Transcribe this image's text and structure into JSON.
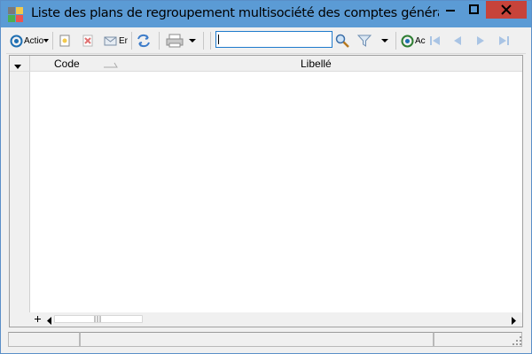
{
  "window": {
    "title": "Liste des plans de regroupement multisociété des comptes généraux"
  },
  "toolbar": {
    "action_label": "Actio",
    "email_label": "Er",
    "activity_label": "Ac",
    "search_value": ""
  },
  "grid": {
    "columns": [
      "Code",
      "Libellé"
    ],
    "rows": []
  },
  "colors": {
    "titlebar": "#5b9bd5",
    "close": "#c7433a",
    "focus": "#1e7acc"
  }
}
